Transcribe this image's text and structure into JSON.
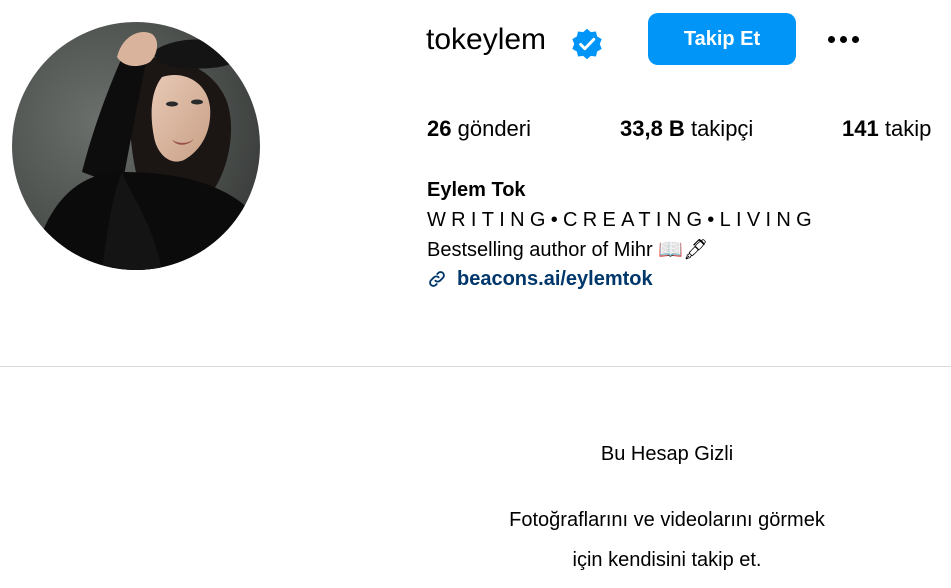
{
  "profile": {
    "username": "tokeylem",
    "follow_label": "Takip Et",
    "verified_icon": "verified-badge-icon",
    "more_icon": "more-options-icon",
    "stats": {
      "posts_value": "26",
      "posts_label": "gönderi",
      "followers_value": "33,8 B",
      "followers_label": "takipçi",
      "following_value": "141",
      "following_label": "takip"
    },
    "full_name": "Eylem Tok",
    "bio": {
      "line1": "WRITING•CREATING•LIVING",
      "line2": "Bestselling author of Mihr 📖🖋"
    },
    "link": {
      "icon": "link-icon",
      "text": "beacons.ai/eylemtok"
    }
  },
  "private_notice": {
    "title": "Bu Hesap Gizli",
    "line1": "Fotoğraflarını ve videolarını görmek",
    "line2": "için kendisini takip et."
  },
  "colors": {
    "accent": "#0095f6",
    "link": "#00376b",
    "divider": "#dbdbdb"
  }
}
